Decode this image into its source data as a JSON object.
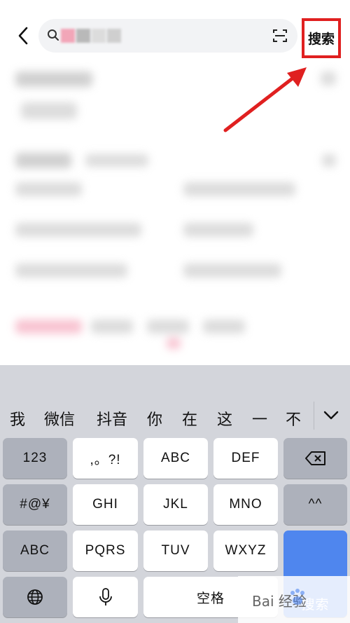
{
  "header": {
    "search_button_label": "搜索",
    "highlight_color": "#e02020"
  },
  "candidates": [
    "我",
    "微信",
    "抖音",
    "你",
    "在",
    "这",
    "一",
    "不"
  ],
  "keyboard": {
    "rows": [
      [
        "123",
        ",。?!",
        "ABC",
        "DEF",
        "⌫"
      ],
      [
        "#@¥",
        "GHI",
        "JKL",
        "MNO",
        "^^"
      ],
      [
        "ABC",
        "PQRS",
        "TUV",
        "WXYZ",
        "搜索"
      ],
      [
        "globe",
        "mic",
        "空格"
      ]
    ],
    "key_123": "123",
    "key_punct": ",。?!",
    "key_abc": "ABC",
    "key_def": "DEF",
    "key_symbols": "#@¥",
    "key_ghi": "GHI",
    "key_jkl": "JKL",
    "key_mno": "MNO",
    "key_emoticon": "^^",
    "key_abc_mode": "ABC",
    "key_pqrs": "PQRS",
    "key_tuv": "TUV",
    "key_wxyz": "WXYZ",
    "key_search": "搜索",
    "key_space": "空格",
    "accent_color": "#4f86ee"
  },
  "watermark": {
    "text": "Bai 经验"
  },
  "icons": [
    "back-arrow-icon",
    "search-icon",
    "scan-icon",
    "collapse-chevron-icon",
    "backspace-icon",
    "globe-icon",
    "microphone-icon",
    "baidu-paw-icon"
  ]
}
